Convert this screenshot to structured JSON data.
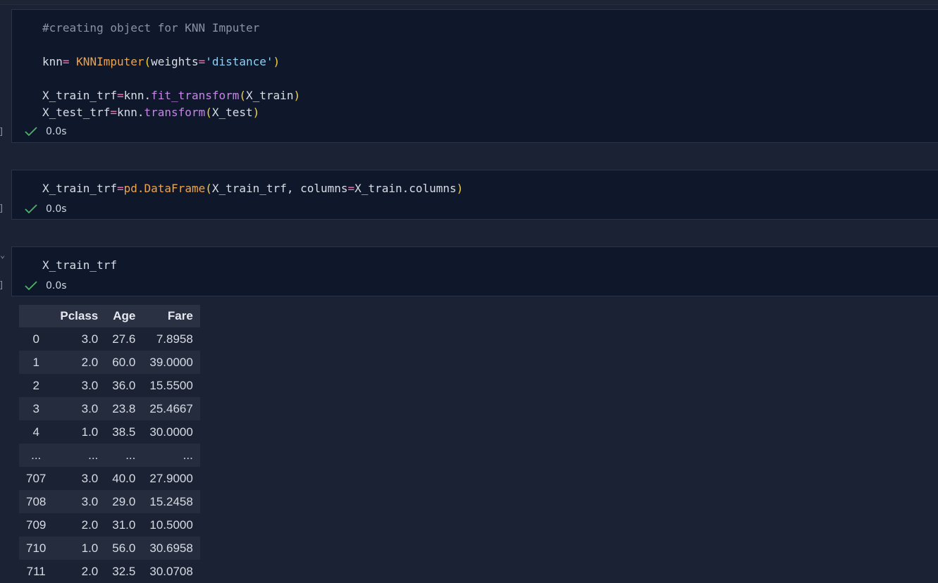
{
  "cells": [
    {
      "exec_marker": "]",
      "status_time": "0.0s",
      "code_lines": [
        [
          {
            "t": "#creating object for KNN Imputer",
            "c": "cm"
          }
        ],
        [],
        [
          {
            "t": "knn",
            "c": "var"
          },
          {
            "t": "= ",
            "c": "op"
          },
          {
            "t": "KNNImputer",
            "c": "cls"
          },
          {
            "t": "(",
            "c": "paren"
          },
          {
            "t": "weights",
            "c": "var"
          },
          {
            "t": "=",
            "c": "op"
          },
          {
            "t": "'distance'",
            "c": "str"
          },
          {
            "t": ")",
            "c": "paren"
          }
        ],
        [],
        [
          {
            "t": "X_train_trf",
            "c": "var"
          },
          {
            "t": "=",
            "c": "op"
          },
          {
            "t": "knn.",
            "c": "var"
          },
          {
            "t": "fit_transform",
            "c": "fn"
          },
          {
            "t": "(",
            "c": "paren"
          },
          {
            "t": "X_train",
            "c": "var"
          },
          {
            "t": ")",
            "c": "paren"
          }
        ],
        [
          {
            "t": "X_test_trf",
            "c": "var"
          },
          {
            "t": "=",
            "c": "op"
          },
          {
            "t": "knn.",
            "c": "var"
          },
          {
            "t": "transform",
            "c": "fn"
          },
          {
            "t": "(",
            "c": "paren"
          },
          {
            "t": "X_test",
            "c": "var"
          },
          {
            "t": ")",
            "c": "paren"
          }
        ]
      ]
    },
    {
      "exec_marker": "]",
      "status_time": "0.0s",
      "code_lines": [
        [
          {
            "t": "X_train_trf",
            "c": "var"
          },
          {
            "t": "=",
            "c": "op"
          },
          {
            "t": "pd.",
            "c": "cls"
          },
          {
            "t": "DataFrame",
            "c": "cls"
          },
          {
            "t": "(",
            "c": "paren"
          },
          {
            "t": "X_train_trf, columns",
            "c": "var"
          },
          {
            "t": "=",
            "c": "op"
          },
          {
            "t": "X_train.columns",
            "c": "var"
          },
          {
            "t": ")",
            "c": "paren"
          }
        ]
      ]
    },
    {
      "exec_marker": "]",
      "status_time": "0.0s",
      "collapse_icon": "chevron-down-icon",
      "code_lines": [
        [
          {
            "t": "X_train_trf",
            "c": "var"
          }
        ]
      ]
    }
  ],
  "dataframe": {
    "columns": [
      "",
      "Pclass",
      "Age",
      "Fare"
    ],
    "rows": [
      [
        "0",
        "3.0",
        "27.6",
        "7.8958"
      ],
      [
        "1",
        "2.0",
        "60.0",
        "39.0000"
      ],
      [
        "2",
        "3.0",
        "36.0",
        "15.5500"
      ],
      [
        "3",
        "3.0",
        "23.8",
        "25.4667"
      ],
      [
        "4",
        "1.0",
        "38.5",
        "30.0000"
      ],
      [
        "...",
        "...",
        "...",
        "..."
      ],
      [
        "707",
        "3.0",
        "40.0",
        "27.9000"
      ],
      [
        "708",
        "3.0",
        "29.0",
        "15.2458"
      ],
      [
        "709",
        "2.0",
        "31.0",
        "10.5000"
      ],
      [
        "710",
        "1.0",
        "56.0",
        "30.6958"
      ],
      [
        "711",
        "2.0",
        "32.5",
        "30.0708"
      ]
    ]
  },
  "colors": {
    "background": "#1b2233",
    "cell_bg": "#0f172a",
    "check_green": "#4fb36a"
  }
}
